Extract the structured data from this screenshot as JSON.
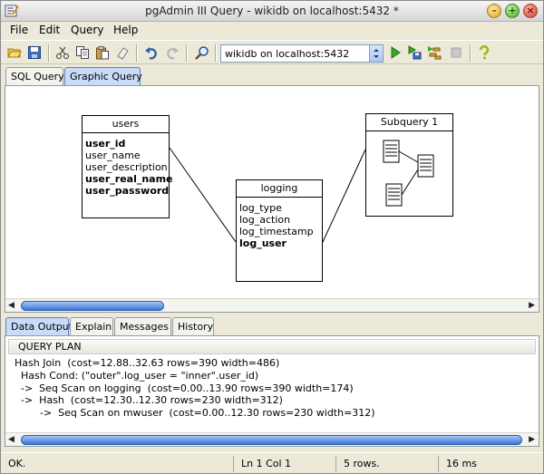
{
  "window": {
    "title": "pgAdmin III Query - wikidb on localhost:5432 *"
  },
  "menu": {
    "items": [
      "File",
      "Edit",
      "Query",
      "Help"
    ]
  },
  "toolbar": {
    "connection": "wikidb on localhost:5432"
  },
  "top_tabs": [
    {
      "label": "SQL Query",
      "active": false
    },
    {
      "label": "Graphic Query",
      "active": true
    }
  ],
  "graphic": {
    "tables": [
      {
        "name": "users",
        "columns": [
          {
            "label": "user_id",
            "bold": true
          },
          {
            "label": "user_name",
            "bold": false
          },
          {
            "label": "user_description",
            "bold": false
          },
          {
            "label": "user_real_name",
            "bold": true
          },
          {
            "label": "user_password",
            "bold": true
          }
        ]
      },
      {
        "name": "logging",
        "columns": [
          {
            "label": "log_type",
            "bold": false
          },
          {
            "label": "log_action",
            "bold": false
          },
          {
            "label": "log_timestamp",
            "bold": false
          },
          {
            "label": "log_user",
            "bold": true
          }
        ]
      },
      {
        "name": "Subquery 1",
        "columns": []
      }
    ]
  },
  "bottom_tabs": [
    {
      "label": "Data Output",
      "active": true
    },
    {
      "label": "Explain",
      "active": false
    },
    {
      "label": "Messages",
      "active": false
    },
    {
      "label": "History",
      "active": false
    }
  ],
  "output": {
    "column_header": "QUERY PLAN",
    "rows": [
      "Hash Join  (cost=12.88..32.63 rows=390 width=486)",
      "  Hash Cond: (\"outer\".log_user = \"inner\".user_id)",
      "  ->  Seq Scan on logging  (cost=0.00..13.90 rows=390 width=174)",
      "  ->  Hash  (cost=12.30..12.30 rows=230 width=312)",
      "        ->  Seq Scan on mwuser  (cost=0.00..12.30 rows=230 width=312)"
    ]
  },
  "status": {
    "message": "OK.",
    "position": "Ln 1 Col 1",
    "rows": "5 rows.",
    "time": "16 ms"
  },
  "icons": [
    "app-icon",
    "open-icon",
    "save-icon",
    "cut-icon",
    "copy-icon",
    "paste-icon",
    "clear-icon",
    "undo-icon",
    "redo-icon",
    "find-icon",
    "execute-icon",
    "execute-to-file-icon",
    "explain-icon",
    "stop-icon",
    "help-icon"
  ]
}
